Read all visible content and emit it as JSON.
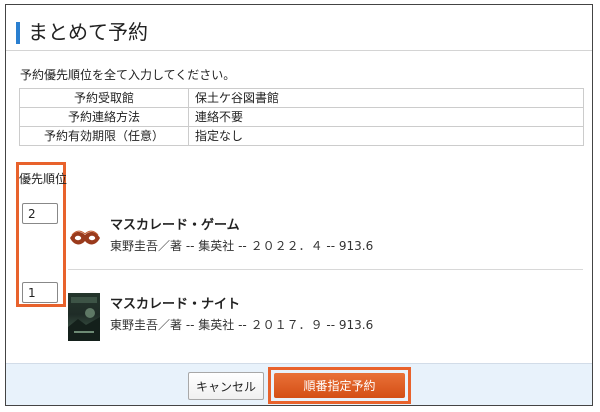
{
  "header": {
    "title": "まとめて予約"
  },
  "instruction": "予約優先順位を全て入力してください。",
  "info_table": [
    {
      "label": "予約受取館",
      "value": "保土ケ谷図書館"
    },
    {
      "label": "予約連絡方法",
      "value": "連絡不要"
    },
    {
      "label": "予約有効期限（任意）",
      "value": "指定なし"
    }
  ],
  "priority": {
    "label": "優先順位"
  },
  "books": [
    {
      "priority": "2",
      "title": "マスカレード・ゲーム",
      "meta": "東野圭吾／著 -- 集英社 -- ２０２２．４ -- 913.6",
      "thumbnail_icon": "masquerade-mask-icon"
    },
    {
      "priority": "1",
      "title": "マスカレード・ナイト",
      "meta": "東野圭吾／著 -- 集英社 -- ２０１７．９ -- 913.6",
      "thumbnail_icon": "book-cover-image"
    }
  ],
  "footer": {
    "cancel_label": "キャンセル",
    "submit_label": "順番指定予約"
  },
  "colors": {
    "accent_bar": "#2a7fd0",
    "highlight_outline": "#e8622c",
    "submit_button": "#e05c22",
    "footer_background": "#e8f2fb"
  }
}
